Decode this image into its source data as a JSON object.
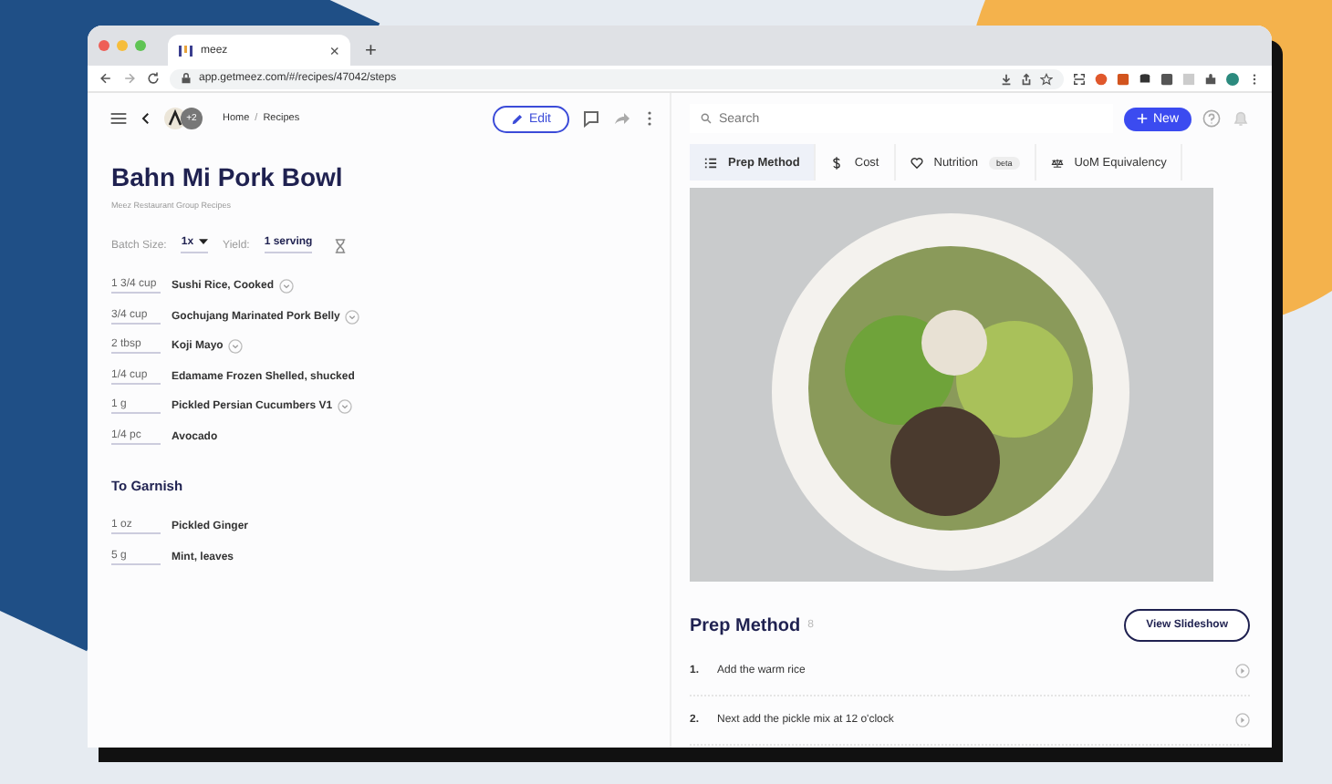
{
  "browser": {
    "tab_title": "meez",
    "tab_close": "×",
    "new_tab": "+",
    "url": "app.getmeez.com/#/recipes/47042/steps"
  },
  "header": {
    "avatar_count": "+2",
    "breadcrumb": [
      "Home",
      "Recipes"
    ],
    "breadcrumb_separator": "/",
    "edit_button": "Edit",
    "search_placeholder": "Search",
    "new_button": "New"
  },
  "tabs": [
    {
      "label": "Prep Method",
      "selected": true
    },
    {
      "label": "Cost",
      "selected": false
    },
    {
      "label": "Nutrition",
      "badge": "beta",
      "selected": false
    },
    {
      "label": "UoM Equivalency",
      "selected": false
    }
  ],
  "recipe": {
    "title": "Bahn Mi Pork Bowl",
    "subtitle": "Meez Restaurant Group Recipes",
    "batch_label": "Batch Size:",
    "batch_value": "1x",
    "yield_label": "Yield:",
    "yield_value": "1 serving"
  },
  "ingredients": [
    {
      "qty": "1 3/4 cup",
      "name": "Sushi Rice, Cooked",
      "expandable": true
    },
    {
      "qty": "3/4 cup",
      "name": "Gochujang Marinated Pork Belly",
      "expandable": true
    },
    {
      "qty": "2 tbsp",
      "name": "Koji Mayo",
      "expandable": true
    },
    {
      "qty": "1/4 cup",
      "name": "Edamame Frozen Shelled, shucked",
      "expandable": false
    },
    {
      "qty": "1 g",
      "name": "Pickled Persian Cucumbers V1",
      "expandable": true
    },
    {
      "qty": "1/4 pc",
      "name": "Avocado",
      "expandable": false
    }
  ],
  "garnish": {
    "title": "To Garnish",
    "items": [
      {
        "qty": "1 oz",
        "name": "Pickled Ginger"
      },
      {
        "qty": "5 g",
        "name": "Mint, leaves"
      }
    ]
  },
  "prep": {
    "title": "Prep Method",
    "count": "8",
    "button": "View Slideshow",
    "steps": [
      {
        "number": "1.",
        "text": "Add the warm rice"
      },
      {
        "number": "2.",
        "text": "Next add the pickle mix at 12 o'clock"
      }
    ]
  }
}
